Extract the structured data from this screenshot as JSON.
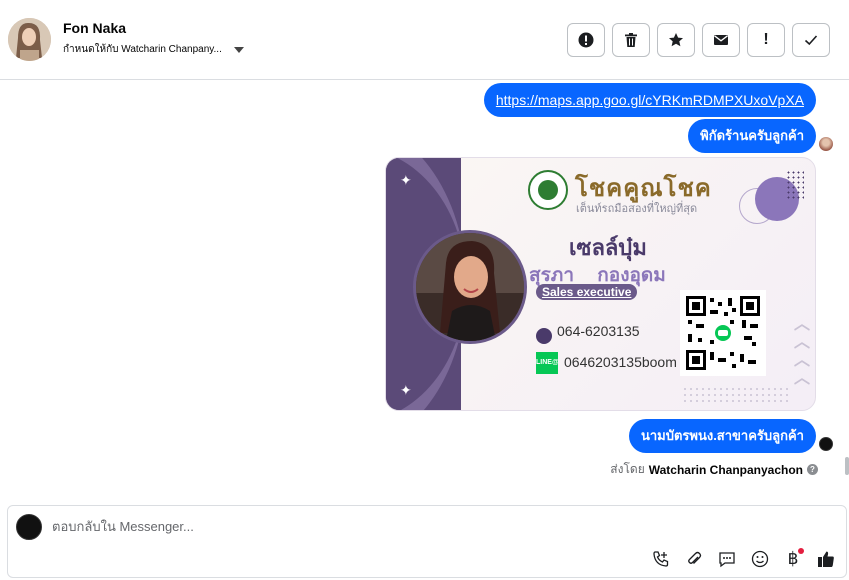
{
  "header": {
    "contact_name": "Fon Naka",
    "assign_label": "กำหนดให้กับ Watcharin Chanpany...",
    "actions": [
      {
        "name": "report-button",
        "icon": "alert-circle-icon"
      },
      {
        "name": "delete-button",
        "icon": "trash-icon"
      },
      {
        "name": "star-button",
        "icon": "star-icon"
      },
      {
        "name": "mark-unread-button",
        "icon": "envelope-icon"
      },
      {
        "name": "follow-up-button",
        "icon": "exclamation-icon",
        "glyph": "!"
      },
      {
        "name": "mark-done-button",
        "icon": "check-icon"
      }
    ]
  },
  "messages": {
    "link_message": "https://maps.app.goo.gl/cYRKmRDMPXUxoVpXA",
    "location_message": "พิกัดร้านครับลูกค้า",
    "card_message": "นามบัตรพนง.สาขาครับลูกค้า"
  },
  "business_card": {
    "brand_title": "โชคคูณโชค",
    "brand_tagline": "เต็นท์รถมือสองที่ใหญ่ที่สุด",
    "nickname": "เซลล์บุ๋ม",
    "full_name": "สุรภา กองอุดม",
    "job_title": "Sales executive",
    "phone": "064-6203135",
    "line_label": "LINE@",
    "line_id": "0646203135boom"
  },
  "sent_by": {
    "prefix": "ส่งโดย",
    "name": "Watcharin Chanpanyachon",
    "info_glyph": "?"
  },
  "composer": {
    "placeholder": "ตอบกลับใน Messenger...",
    "baht_glyph": "฿",
    "tools": [
      "call-add-icon",
      "paperclip-icon",
      "saved-reply-icon",
      "emoji-icon",
      "payment-icon",
      "like-icon"
    ]
  },
  "colors": {
    "bubble": "#0866ff",
    "card_purple": "#5b4a78",
    "line_green": "#06c755"
  }
}
